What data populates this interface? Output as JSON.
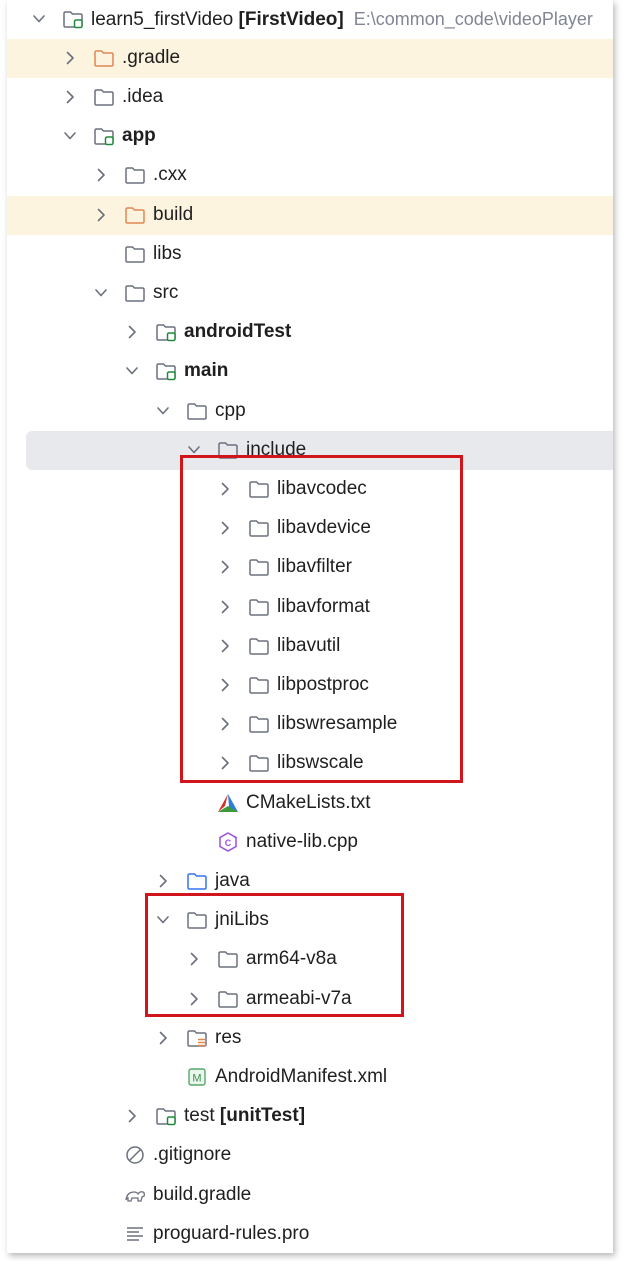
{
  "project": {
    "name": "learn5_firstVideo",
    "module": "[FirstVideo]",
    "path": "E:\\common_code\\videoPlayer"
  },
  "tree": [
    {
      "label": "learn5_firstVideo",
      "suffix": " [FirstVideo]",
      "path": "E:\\common_code\\videoPlayer",
      "arrow": "down",
      "icon": "module-folder-icon"
    },
    {
      "label": ".gradle",
      "arrow": "right",
      "icon": "folder-orange-icon",
      "state": "excluded"
    },
    {
      "label": ".idea",
      "arrow": "right",
      "icon": "folder-icon"
    },
    {
      "label": "app",
      "arrow": "down",
      "icon": "module-folder-icon",
      "bold": true
    },
    {
      "label": ".cxx",
      "arrow": "right",
      "icon": "folder-icon"
    },
    {
      "label": "build",
      "arrow": "right",
      "icon": "folder-orange-icon",
      "state": "excluded"
    },
    {
      "label": "libs",
      "icon": "folder-icon"
    },
    {
      "label": "src",
      "arrow": "down",
      "icon": "folder-icon"
    },
    {
      "label": "androidTest",
      "arrow": "right",
      "icon": "test-root-folder-icon",
      "bold": true
    },
    {
      "label": "main",
      "arrow": "down",
      "icon": "module-folder-icon",
      "bold": true
    },
    {
      "label": "cpp",
      "arrow": "down",
      "icon": "folder-icon"
    },
    {
      "label": "include",
      "arrow": "down",
      "icon": "folder-icon",
      "state": "selected"
    },
    {
      "label": "libavcodec",
      "arrow": "right",
      "icon": "folder-icon"
    },
    {
      "label": "libavdevice",
      "arrow": "right",
      "icon": "folder-icon"
    },
    {
      "label": "libavfilter",
      "arrow": "right",
      "icon": "folder-icon"
    },
    {
      "label": "libavformat",
      "arrow": "right",
      "icon": "folder-icon"
    },
    {
      "label": "libavutil",
      "arrow": "right",
      "icon": "folder-icon"
    },
    {
      "label": "libpostproc",
      "arrow": "right",
      "icon": "folder-icon"
    },
    {
      "label": "libswresample",
      "arrow": "right",
      "icon": "folder-icon"
    },
    {
      "label": "libswscale",
      "arrow": "right",
      "icon": "folder-icon"
    },
    {
      "label": "CMakeLists.txt",
      "icon": "cmake-icon"
    },
    {
      "label": "native-lib.cpp",
      "icon": "cpp-file-icon"
    },
    {
      "label": "java",
      "arrow": "right",
      "icon": "source-folder-icon"
    },
    {
      "label": "jniLibs",
      "arrow": "down",
      "icon": "folder-icon"
    },
    {
      "label": "arm64-v8a",
      "arrow": "right",
      "icon": "folder-icon"
    },
    {
      "label": "armeabi-v7a",
      "arrow": "right",
      "icon": "folder-icon"
    },
    {
      "label": "res",
      "arrow": "right",
      "icon": "resource-folder-icon"
    },
    {
      "label": "AndroidManifest.xml",
      "icon": "manifest-file-icon"
    },
    {
      "label": "test",
      "suffix": " [unitTest]",
      "arrow": "right",
      "icon": "test-root-folder-icon"
    },
    {
      "label": ".gitignore",
      "icon": "gitignore-icon"
    },
    {
      "label": "build.gradle",
      "icon": "gradle-file-icon"
    },
    {
      "label": "proguard-rules.pro",
      "icon": "text-file-icon"
    }
  ],
  "colors": {
    "excluded_row_bg": "#fdf4e0",
    "selected_row_bg": "#e8e9ec",
    "folder_stroke": "#6c707e",
    "orange_folder_stroke": "#e08855",
    "source_folder_stroke": "#3574f0",
    "module_badge": "#208a3c",
    "highlight_box": "#d0161c"
  }
}
